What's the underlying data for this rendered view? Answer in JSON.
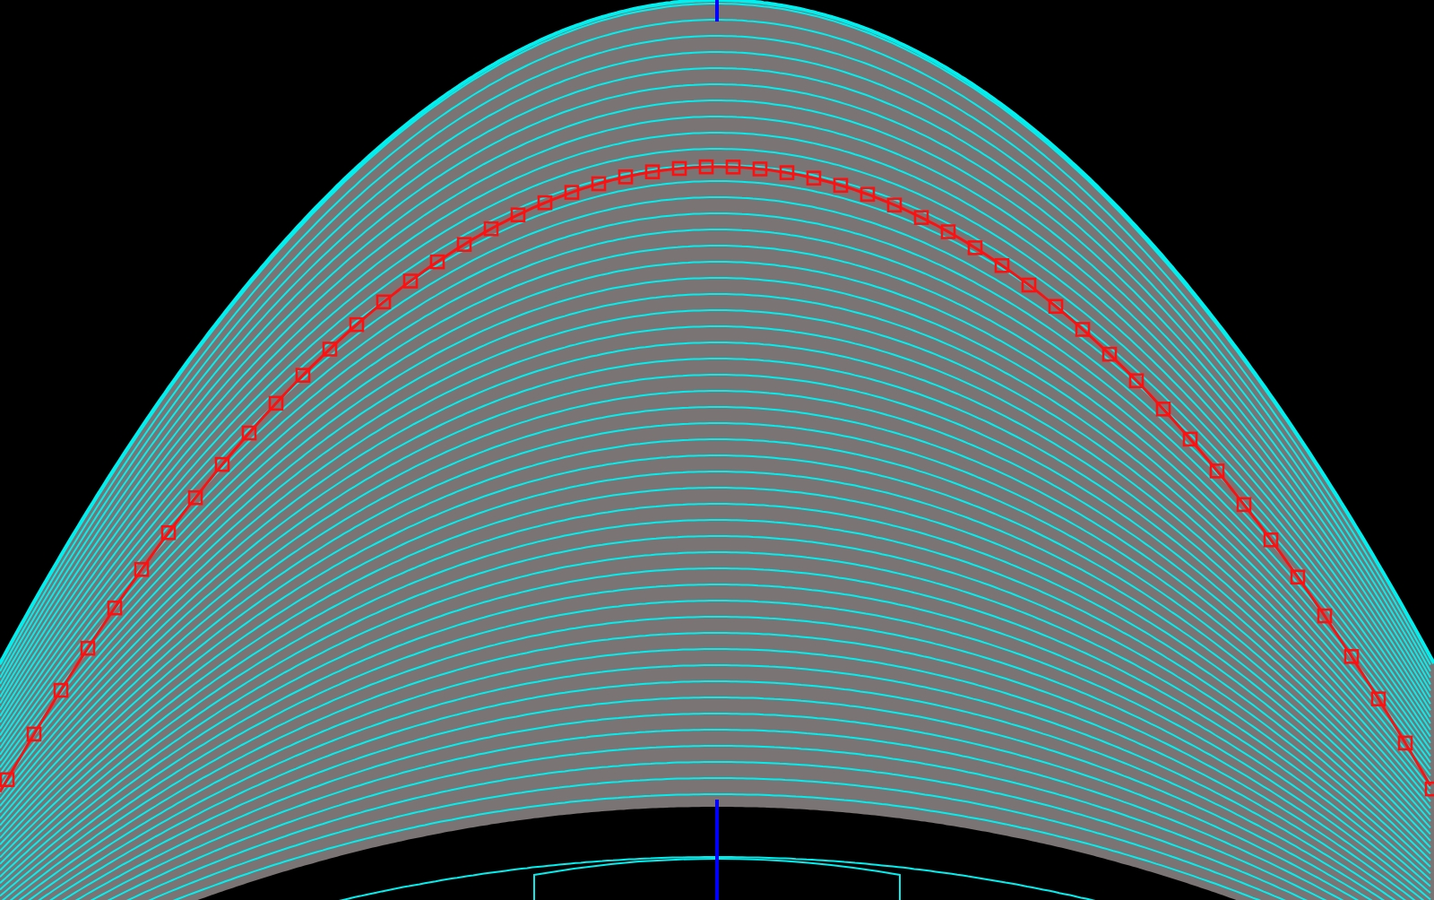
{
  "viewport": {
    "marker_curve": true,
    "axis_line": true
  }
}
